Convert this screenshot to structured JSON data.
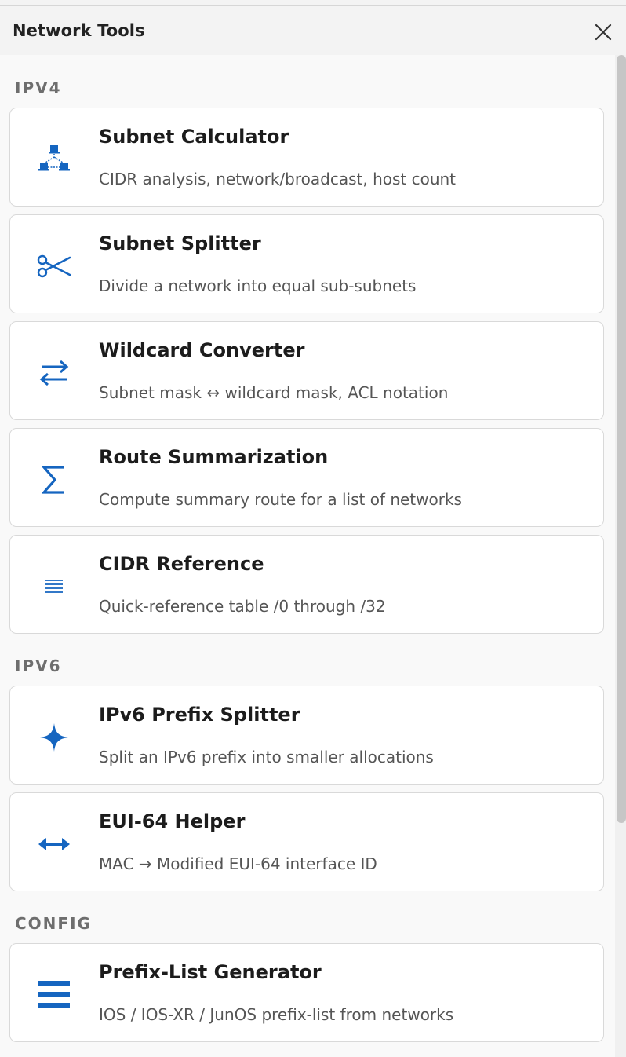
{
  "header": {
    "title": "Network Tools",
    "close_icon": "close-icon"
  },
  "sections": [
    {
      "label": "IPV4",
      "items": [
        {
          "title": "Subnet Calculator",
          "description": "CIDR analysis, network/broadcast, host count",
          "icon": "network-topology-icon"
        },
        {
          "title": "Subnet Splitter",
          "description": "Divide a network into equal sub-subnets",
          "icon": "scissors-icon"
        },
        {
          "title": "Wildcard Converter",
          "description": "Subnet mask ↔ wildcard mask, ACL notation",
          "icon": "swap-arrows-icon"
        },
        {
          "title": "Route Summarization",
          "description": "Compute summary route for a list of networks",
          "icon": "sigma-icon"
        },
        {
          "title": "CIDR Reference",
          "description": "Quick-reference table /0 through /32",
          "icon": "lines-icon"
        }
      ]
    },
    {
      "label": "IPV6",
      "items": [
        {
          "title": "IPv6 Prefix Splitter",
          "description": "Split an IPv6 prefix into smaller allocations",
          "icon": "sparkle-icon"
        },
        {
          "title": "EUI-64 Helper",
          "description": "MAC → Modified EUI-64 interface ID",
          "icon": "double-arrow-icon"
        }
      ]
    },
    {
      "label": "CONFIG",
      "items": [
        {
          "title": "Prefix-List Generator",
          "description": "IOS / IOS-XR / JunOS prefix-list from networks",
          "icon": "menu-bars-icon"
        }
      ]
    }
  ],
  "colors": {
    "accent": "#1565c0",
    "background": "#f3f3f3",
    "card": "#ffffff",
    "section_label": "#6e6e6e"
  }
}
